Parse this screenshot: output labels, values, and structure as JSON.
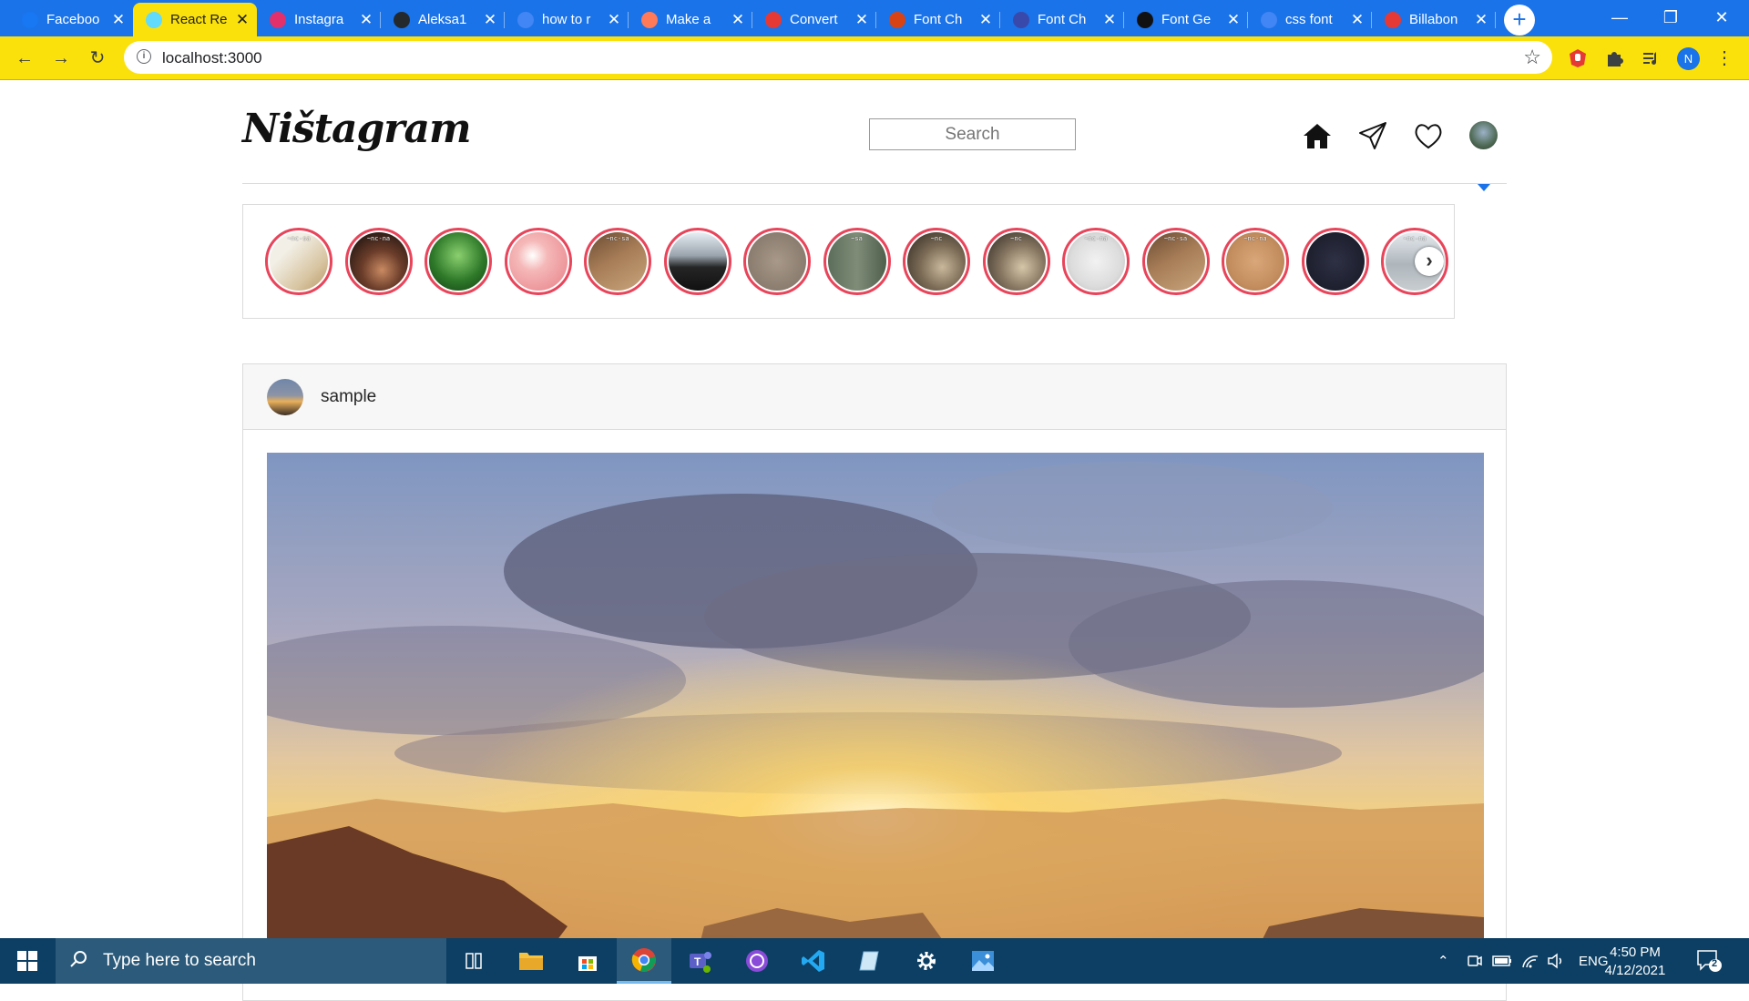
{
  "browser": {
    "tabs": [
      {
        "title": "Faceboo",
        "favicon": "facebook-icon",
        "color": "#1877f2"
      },
      {
        "title": "React Re",
        "favicon": "react-icon",
        "color": "#61dafb"
      },
      {
        "title": "Instagra",
        "favicon": "instagram-icon",
        "color": "#e1306c"
      },
      {
        "title": "Aleksa1",
        "favicon": "github-icon",
        "color": "#24292e"
      },
      {
        "title": "how to r",
        "favicon": "google-icon",
        "color": "#4285f4"
      },
      {
        "title": "Make a ",
        "favicon": "make-icon",
        "color": "#ff7a59"
      },
      {
        "title": "Convert",
        "favicon": "convert-icon",
        "color": "#e53935"
      },
      {
        "title": "Font Ch",
        "favicon": "font-icon",
        "color": "#d84315"
      },
      {
        "title": "Font Ch",
        "favicon": "fc-icon",
        "color": "#3949ab"
      },
      {
        "title": "Font Ge",
        "favicon": "font-generator-icon",
        "color": "#111111"
      },
      {
        "title": "css font",
        "favicon": "google-icon",
        "color": "#4285f4"
      },
      {
        "title": "Billabon",
        "favicon": "record-icon",
        "color": "#e53935"
      }
    ],
    "active_tab_index": 1,
    "url": "localhost:3000",
    "profile_initial": "N",
    "theme_colors": {
      "tabstrip": "#1a73e8",
      "toolbar": "#fbe10b"
    }
  },
  "app": {
    "logo": "Ništagram",
    "search_placeholder": "Search",
    "nav_icons": [
      "home-icon",
      "send-icon",
      "heart-icon",
      "profile-avatar"
    ],
    "stories": [
      {
        "label": "~nc-sa",
        "fill": "linear-gradient(135deg,#f2efe6 30%,#d8c5a2 70%,#b89968)"
      },
      {
        "label": "~nc-na",
        "fill": "radial-gradient(circle at 55% 65%,#c98a62 0%,#6b3d2a 40%,#2a1a14 80%)"
      },
      {
        "label": "",
        "fill": "radial-gradient(circle at 50% 40%,#8bd06f 0%,#2f7a2a 55%,#123d12 100%)"
      },
      {
        "label": "",
        "fill": "radial-gradient(circle at 40% 40%,#ffffff 0%,#f5b8b8 30%,#e77f86 100%)"
      },
      {
        "label": "~nc-sa",
        "fill": "linear-gradient(150deg,#6a4a32 0%,#a67c56 45%,#c9a57c 100%)"
      },
      {
        "label": "",
        "fill": "linear-gradient(180deg,#e8eef4 0%,#9aa4ad 40%,#252525 60%,#111 100%)"
      },
      {
        "label": "",
        "fill": "radial-gradient(circle at 50% 50%,#a8998a 0%,#8a7c6e 70%,#6d6358 100%)"
      },
      {
        "label": "~sa",
        "fill": "linear-gradient(90deg,#5c6f5a 0%,#7f8c78 50%,#4e5f4c 100%)"
      },
      {
        "label": "~nc",
        "fill": "radial-gradient(circle at 60% 60%,#c9b89b 0%,#7a6a55 45%,#2a241e 100%)"
      },
      {
        "label": "~nc",
        "fill": "radial-gradient(circle at 60% 60%,#d6c6a8 0%,#857560 45%,#2b2520 100%)"
      },
      {
        "label": "~nc-na",
        "fill": "radial-gradient(circle at 50% 50%,#f2f2f2 0%,#dcdcdc 60%,#b9b9b9 100%)"
      },
      {
        "label": "~nc-sa",
        "fill": "linear-gradient(150deg,#6a4a32 0%,#a67c56 45%,#c9a57c 100%)"
      },
      {
        "label": "~nc-na",
        "fill": "radial-gradient(circle at 50% 50%,#d9a77a 0%,#c48e5f 60%,#a8744a 100%)"
      },
      {
        "label": "",
        "fill": "radial-gradient(circle at 50% 50%,#2e3144 0%,#1d1f2e 70%,#141520 100%)"
      },
      {
        "label": "~nc-na",
        "fill": "linear-gradient(180deg,#e6eaee 0%,#aeb6bc 55%,#c8cdd0 100%)"
      }
    ],
    "post": {
      "username": "sample",
      "image_alt": "sunset-over-canyon"
    }
  },
  "taskbar": {
    "search_placeholder": "Type here to search",
    "language": "ENG",
    "time": "4:50 PM",
    "date": "4/12/2021",
    "notification_count": "2"
  }
}
